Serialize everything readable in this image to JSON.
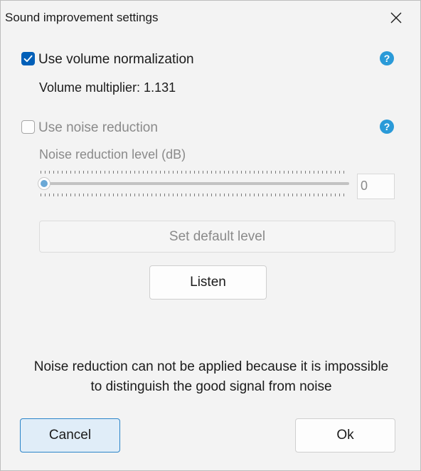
{
  "dialog": {
    "title": "Sound improvement settings",
    "close_icon": "close-icon"
  },
  "normalization": {
    "checkbox_label": "Use volume normalization",
    "checked": true,
    "multiplier_text": "Volume multiplier: 1.131",
    "help_label": "?"
  },
  "noise_reduction": {
    "checkbox_label": "Use noise reduction",
    "checked": false,
    "enabled": false,
    "help_label": "?",
    "level_label": "Noise reduction level (dB)",
    "level_value": "0",
    "slider_fraction": 0,
    "default_button_label": "Set default level"
  },
  "listen_button_label": "Listen",
  "info_message": {
    "line1": "Noise reduction can not be applied because it is impossible",
    "line2": "to distinguish the good signal from noise"
  },
  "footer": {
    "cancel_label": "Cancel",
    "ok_label": "Ok"
  },
  "colors": {
    "accent": "#005fb8",
    "help_icon": "#2a9ad8",
    "disabled_text": "#8a8a8a"
  }
}
